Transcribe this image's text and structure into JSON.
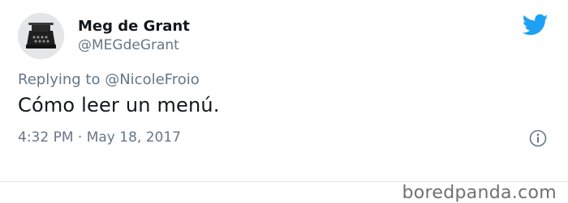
{
  "tweet": {
    "author_name": "Meg de Grant",
    "author_handle": "@MEGdeGrant",
    "reply_prefix": "Replying to",
    "reply_to": "@NicoleFroio",
    "text": "Cómo leer un menú.",
    "timestamp": "4:32 PM · May 18, 2017"
  },
  "icons": {
    "avatar": "typewriter-avatar",
    "brand": "twitter-bird-icon",
    "info": "info-icon"
  },
  "colors": {
    "brand": "#1da1f2",
    "secondary_text": "#657786",
    "primary_text": "#14171a"
  },
  "watermark": {
    "text": "boredpanda.com"
  }
}
